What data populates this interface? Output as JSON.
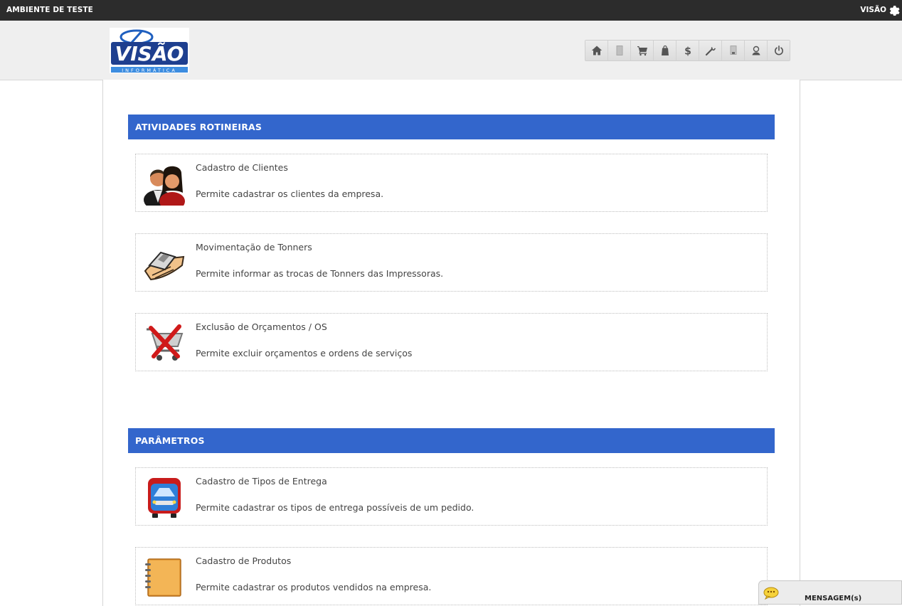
{
  "topbar": {
    "environment": "AMBIENTE DE TESTE",
    "user": "VISÃO",
    "gear_icon": "gear-icon"
  },
  "logo": {
    "brand": "VISÃO",
    "subtitle": "INFORMÁTICA"
  },
  "toolbar": {
    "icons": [
      "home-icon",
      "document-icon",
      "cart-icon",
      "bag-icon",
      "dollar-icon",
      "wrench-icon",
      "printer-icon",
      "user-icon",
      "power-icon"
    ],
    "dollar_glyph": "$"
  },
  "sections": [
    {
      "title": "ATIVIDADES ROTINEIRAS",
      "items": [
        {
          "title": "Cadastro de Clientes",
          "description": "Permite cadastrar os clientes da empresa.",
          "icon": "users-icon"
        },
        {
          "title": "Movimentação de Tonners",
          "description": "Permite informar as trocas de Tonners das Impressoras.",
          "icon": "toner-hand-icon"
        },
        {
          "title": "Exclusão de Orçamentos / OS",
          "description": "Permite excluir orçamentos e ordens de serviços",
          "icon": "cart-delete-icon"
        }
      ]
    },
    {
      "title": "PARÂMETROS",
      "items": [
        {
          "title": "Cadastro de Tipos de Entrega",
          "description": "Permite cadastrar os tipos de entrega possíveis de um pedido.",
          "icon": "truck-icon"
        },
        {
          "title": "Cadastro de Produtos",
          "description": "Permite cadastrar os produtos vendidos na empresa.",
          "icon": "notebook-icon"
        }
      ]
    }
  ],
  "messages": {
    "label": "MENSAGEM(s)",
    "icon": "chat-bubble-icon"
  },
  "colors": {
    "section_header": "#3366cc",
    "topbar": "#2c2c2c",
    "header_bg": "#efefef"
  }
}
